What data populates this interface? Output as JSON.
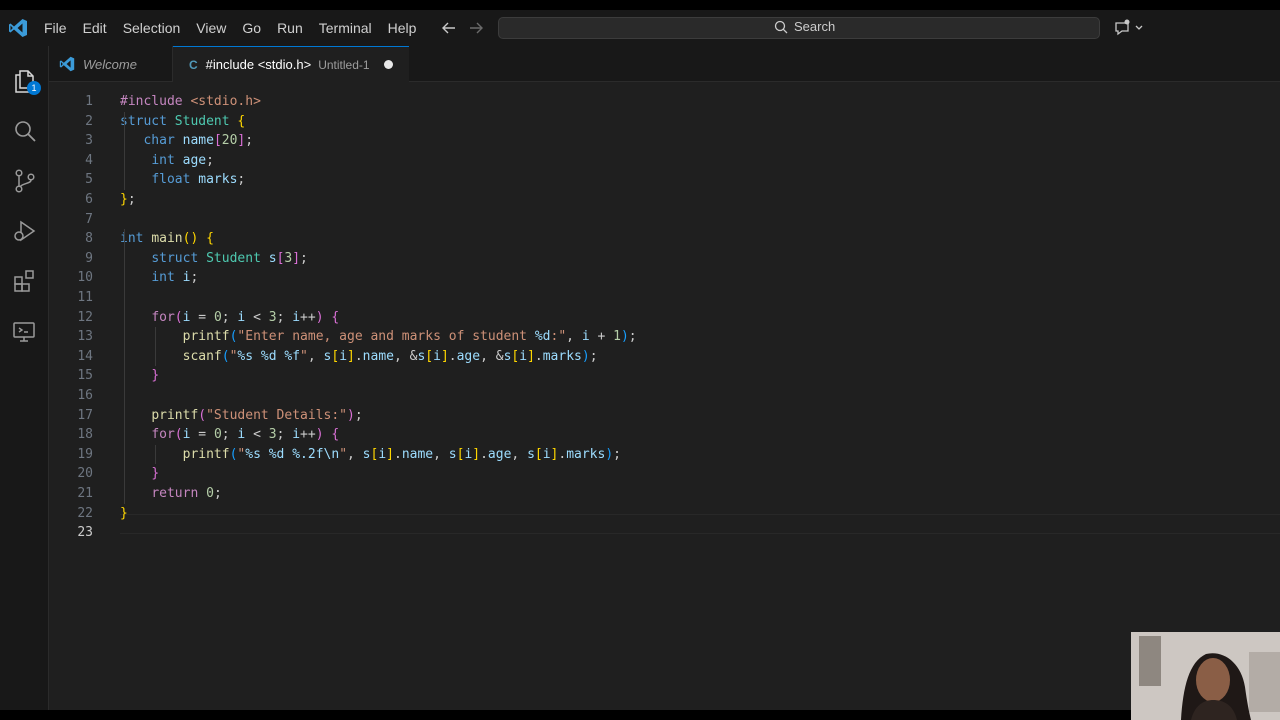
{
  "menu": [
    "File",
    "Edit",
    "Selection",
    "View",
    "Go",
    "Run",
    "Terminal",
    "Help"
  ],
  "search": {
    "label": "Search"
  },
  "activity": {
    "explorer_badge": "1"
  },
  "tabs": {
    "welcome": "Welcome",
    "active_lang": "C",
    "active_title": "#include <stdio.h>",
    "active_desc": "Untitled-1"
  },
  "editor": {
    "line_numbers": [
      "1",
      "2",
      "3",
      "4",
      "5",
      "6",
      "7",
      "8",
      "9",
      "10",
      "11",
      "12",
      "13",
      "14",
      "15",
      "16",
      "17",
      "18",
      "19",
      "20",
      "21",
      "22",
      "23"
    ],
    "lines": [
      [
        [
          "pp",
          "#include "
        ],
        [
          "inc",
          "<stdio.h>"
        ]
      ],
      [
        [
          "kw",
          "struct "
        ],
        [
          "ty",
          "Student "
        ],
        [
          "br1",
          "{"
        ]
      ],
      [
        [
          "pl",
          "   "
        ],
        [
          "kw",
          "char "
        ],
        [
          "vr",
          "name"
        ],
        [
          "br2",
          "["
        ],
        [
          "nu",
          "20"
        ],
        [
          "br2",
          "]"
        ],
        [
          "pl",
          ";"
        ]
      ],
      [
        [
          "pl",
          "    "
        ],
        [
          "kw",
          "int "
        ],
        [
          "vr",
          "age"
        ],
        [
          "pl",
          ";"
        ]
      ],
      [
        [
          "pl",
          "    "
        ],
        [
          "kw",
          "float "
        ],
        [
          "vr",
          "marks"
        ],
        [
          "pl",
          ";"
        ]
      ],
      [
        [
          "br1",
          "}"
        ],
        [
          "pl",
          ";"
        ]
      ],
      [],
      [
        [
          "kw",
          "int "
        ],
        [
          "fn",
          "main"
        ],
        [
          "br1",
          "()"
        ],
        [
          "pl",
          " "
        ],
        [
          "br1",
          "{"
        ]
      ],
      [
        [
          "pl",
          "    "
        ],
        [
          "kw",
          "struct "
        ],
        [
          "ty",
          "Student "
        ],
        [
          "vr",
          "s"
        ],
        [
          "br2",
          "["
        ],
        [
          "nu",
          "3"
        ],
        [
          "br2",
          "]"
        ],
        [
          "pl",
          ";"
        ]
      ],
      [
        [
          "pl",
          "    "
        ],
        [
          "kw",
          "int "
        ],
        [
          "vr",
          "i"
        ],
        [
          "pl",
          ";"
        ]
      ],
      [],
      [
        [
          "pl",
          "    "
        ],
        [
          "ctl",
          "for"
        ],
        [
          "br2",
          "("
        ],
        [
          "vr",
          "i"
        ],
        [
          "pl",
          " = "
        ],
        [
          "nu",
          "0"
        ],
        [
          "pl",
          "; "
        ],
        [
          "vr",
          "i"
        ],
        [
          "pl",
          " < "
        ],
        [
          "nu",
          "3"
        ],
        [
          "pl",
          "; "
        ],
        [
          "vr",
          "i"
        ],
        [
          "pl",
          "++"
        ],
        [
          "br2",
          ")"
        ],
        [
          "pl",
          " "
        ],
        [
          "br2",
          "{"
        ]
      ],
      [
        [
          "pl",
          "        "
        ],
        [
          "fn",
          "printf"
        ],
        [
          "br3",
          "("
        ],
        [
          "st",
          "\"Enter name, age and marks of student "
        ],
        [
          "vr",
          "%d"
        ],
        [
          "st",
          ":\""
        ],
        [
          "pl",
          ", "
        ],
        [
          "vr",
          "i"
        ],
        [
          "pl",
          " + "
        ],
        [
          "nu",
          "1"
        ],
        [
          "br3",
          ")"
        ],
        [
          "pl",
          ";"
        ]
      ],
      [
        [
          "pl",
          "        "
        ],
        [
          "fn",
          "scanf"
        ],
        [
          "br3",
          "("
        ],
        [
          "st",
          "\""
        ],
        [
          "vr",
          "%s %d %f"
        ],
        [
          "st",
          "\""
        ],
        [
          "pl",
          ", "
        ],
        [
          "vr",
          "s"
        ],
        [
          "br1",
          "["
        ],
        [
          "vr",
          "i"
        ],
        [
          "br1",
          "]"
        ],
        [
          "pl",
          "."
        ],
        [
          "vr",
          "name"
        ],
        [
          "pl",
          ", &"
        ],
        [
          "vr",
          "s"
        ],
        [
          "br1",
          "["
        ],
        [
          "vr",
          "i"
        ],
        [
          "br1",
          "]"
        ],
        [
          "pl",
          "."
        ],
        [
          "vr",
          "age"
        ],
        [
          "pl",
          ", &"
        ],
        [
          "vr",
          "s"
        ],
        [
          "br1",
          "["
        ],
        [
          "vr",
          "i"
        ],
        [
          "br1",
          "]"
        ],
        [
          "pl",
          "."
        ],
        [
          "vr",
          "marks"
        ],
        [
          "br3",
          ")"
        ],
        [
          "pl",
          ";"
        ]
      ],
      [
        [
          "pl",
          "    "
        ],
        [
          "br2",
          "}"
        ]
      ],
      [],
      [
        [
          "pl",
          "    "
        ],
        [
          "fn",
          "printf"
        ],
        [
          "br2",
          "("
        ],
        [
          "st",
          "\"Student Details:\""
        ],
        [
          "br2",
          ")"
        ],
        [
          "pl",
          ";"
        ]
      ],
      [
        [
          "pl",
          "    "
        ],
        [
          "ctl",
          "for"
        ],
        [
          "br2",
          "("
        ],
        [
          "vr",
          "i"
        ],
        [
          "pl",
          " = "
        ],
        [
          "nu",
          "0"
        ],
        [
          "pl",
          "; "
        ],
        [
          "vr",
          "i"
        ],
        [
          "pl",
          " < "
        ],
        [
          "nu",
          "3"
        ],
        [
          "pl",
          "; "
        ],
        [
          "vr",
          "i"
        ],
        [
          "pl",
          "++"
        ],
        [
          "br2",
          ")"
        ],
        [
          "pl",
          " "
        ],
        [
          "br2",
          "{"
        ]
      ],
      [
        [
          "pl",
          "        "
        ],
        [
          "fn",
          "printf"
        ],
        [
          "br3",
          "("
        ],
        [
          "st",
          "\""
        ],
        [
          "vr",
          "%s %d %.2f"
        ],
        [
          "vr",
          "\\n"
        ],
        [
          "st",
          "\""
        ],
        [
          "pl",
          ", "
        ],
        [
          "vr",
          "s"
        ],
        [
          "br1",
          "["
        ],
        [
          "vr",
          "i"
        ],
        [
          "br1",
          "]"
        ],
        [
          "pl",
          "."
        ],
        [
          "vr",
          "name"
        ],
        [
          "pl",
          ", "
        ],
        [
          "vr",
          "s"
        ],
        [
          "br1",
          "["
        ],
        [
          "vr",
          "i"
        ],
        [
          "br1",
          "]"
        ],
        [
          "pl",
          "."
        ],
        [
          "vr",
          "age"
        ],
        [
          "pl",
          ", "
        ],
        [
          "vr",
          "s"
        ],
        [
          "br1",
          "["
        ],
        [
          "vr",
          "i"
        ],
        [
          "br1",
          "]"
        ],
        [
          "pl",
          "."
        ],
        [
          "vr",
          "marks"
        ],
        [
          "br3",
          ")"
        ],
        [
          "pl",
          ";"
        ]
      ],
      [
        [
          "pl",
          "    "
        ],
        [
          "br2",
          "}"
        ]
      ],
      [
        [
          "pl",
          "    "
        ],
        [
          "ctl",
          "return "
        ],
        [
          "nu",
          "0"
        ],
        [
          "pl",
          ";"
        ]
      ],
      [
        [
          "br1",
          "}"
        ]
      ],
      []
    ]
  }
}
